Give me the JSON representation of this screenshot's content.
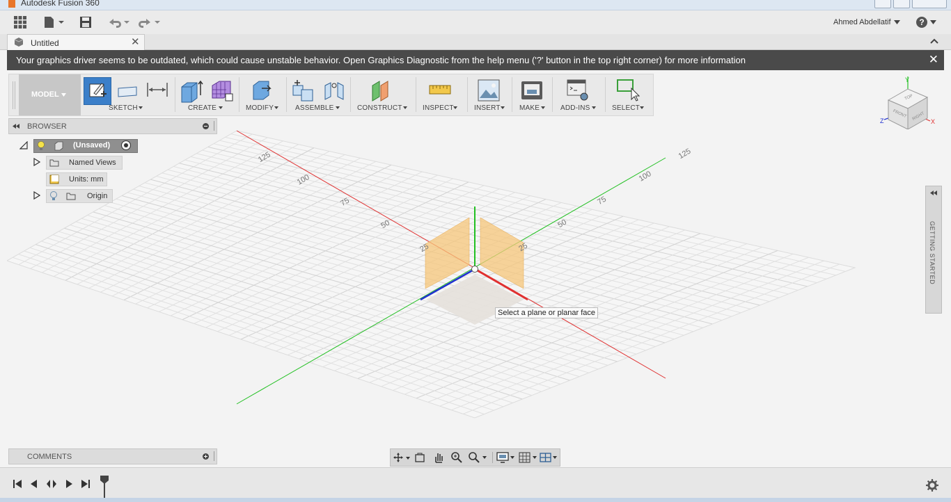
{
  "window": {
    "title": "Autodesk Fusion 360"
  },
  "toolbar": {
    "user_name": "Ahmed Abdellatif",
    "help_label": "?"
  },
  "document": {
    "tab_title": "Untitled"
  },
  "banner": {
    "message": "Your graphics driver seems to be outdated, which could cause unstable behavior. Open Graphics Diagnostic from the help menu ('?' button in the top right corner) for more information"
  },
  "ribbon": {
    "workspace": "MODEL",
    "groups": [
      "SKETCH",
      "CREATE",
      "MODIFY",
      "ASSEMBLE",
      "CONSTRUCT",
      "INSPECT",
      "INSERT",
      "MAKE",
      "ADD-INS",
      "SELECT"
    ]
  },
  "browser": {
    "title": "BROWSER",
    "root_label": "(Unsaved)",
    "nodes": [
      "Named Views",
      "Units: mm",
      "Origin"
    ]
  },
  "comments": {
    "title": "COMMENTS"
  },
  "viewcube": {
    "top": "TOP",
    "front": "FRONT",
    "right": "RIGHT",
    "axis_x": "X",
    "axis_y": "Y",
    "axis_z": "Z"
  },
  "getting_started": {
    "label": "GETTING STARTED"
  },
  "viewport": {
    "tooltip": "Select a plane or planar face",
    "x_axis_ticks": [
      "25",
      "50",
      "75",
      "100",
      "125"
    ],
    "z_axis_ticks": [
      "25",
      "50",
      "75",
      "100",
      "125"
    ]
  },
  "colors": {
    "accent_blue": "#2f78c4",
    "x_axis": "#e03030",
    "y_axis": "#22c022",
    "z_axis": "#2030d0",
    "plane": "#f5c67a",
    "banner_bg": "#4a4a4a"
  }
}
